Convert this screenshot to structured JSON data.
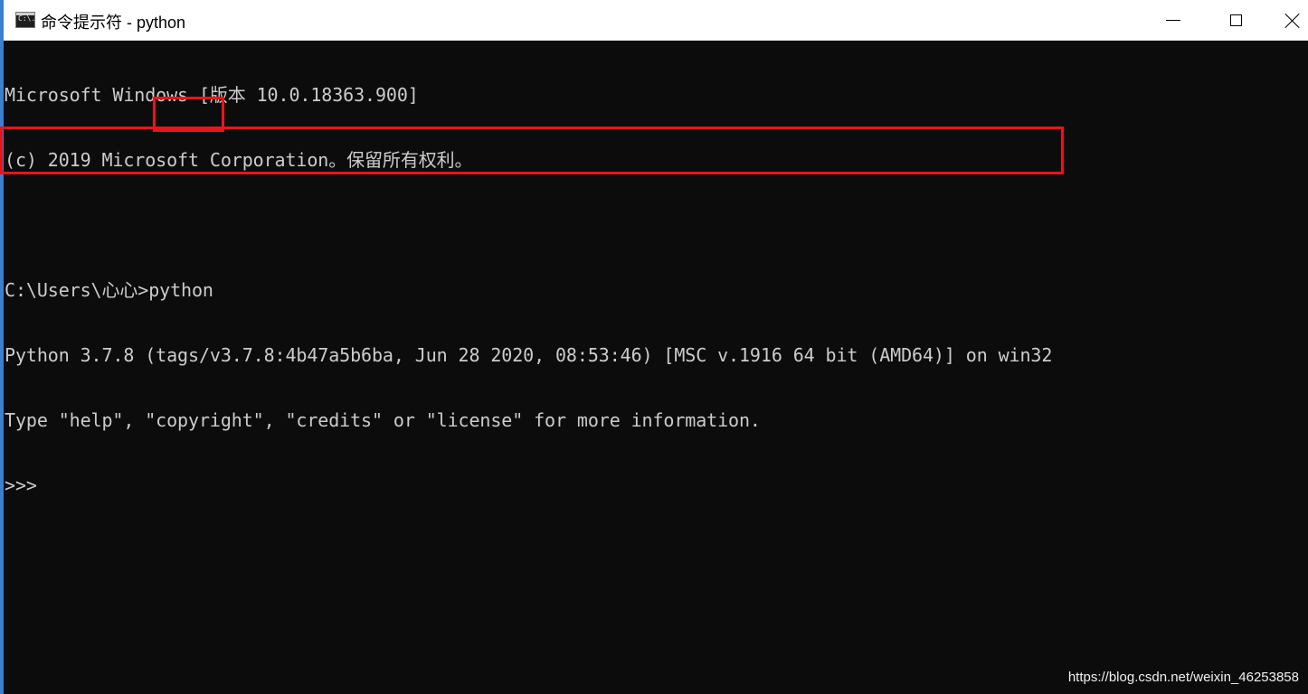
{
  "window": {
    "title": "命令提示符 - python",
    "icon": "cmd-icon",
    "icon_text": "C:\\."
  },
  "controls": {
    "minimize": "minimize-icon",
    "maximize": "maximize-icon",
    "close": "close-icon"
  },
  "console": {
    "lines": [
      "Microsoft Windows [版本 10.0.18363.900]",
      "(c) 2019 Microsoft Corporation。保留所有权利。",
      "",
      "C:\\Users\\心心>python",
      "Python 3.7.8 (tags/v3.7.8:4b47a5b6ba, Jun 28 2020, 08:53:46) [MSC v.1916 64 bit (AMD64)] on win32",
      "Type \"help\", \"copyright\", \"credits\" or \"license\" for more information.",
      ">>>"
    ],
    "prompt_path": "C:\\Users\\心心>",
    "command": "python"
  },
  "colors": {
    "console_bg": "#0c0c0c",
    "console_fg": "#cccccc",
    "highlight": "#e8141b",
    "titlebar_bg": "#ffffff"
  },
  "watermark": "https://blog.csdn.net/weixin_46253858"
}
